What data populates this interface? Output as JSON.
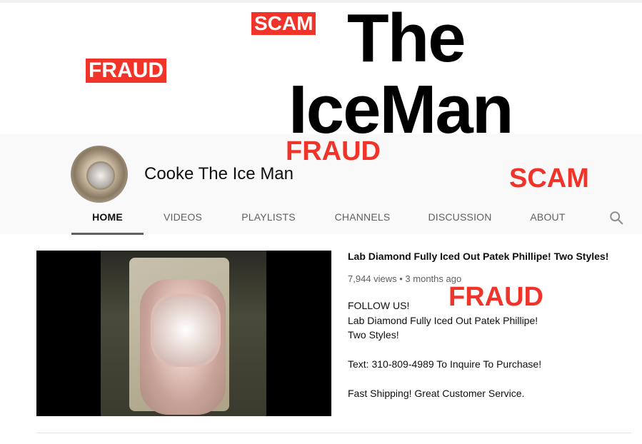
{
  "banner": {
    "title_line1": "The",
    "title_line2": "IceMan"
  },
  "stamps": {
    "scam_top": "SCAM",
    "fraud_left": "FRAUD",
    "fraud_mid": "FRAUD",
    "scam_right": "SCAM",
    "fraud_video": "FRAUD"
  },
  "channel": {
    "name": "Cooke The Ice Man"
  },
  "tabs": [
    {
      "label": "HOME",
      "active": true
    },
    {
      "label": "VIDEOS"
    },
    {
      "label": "PLAYLISTS"
    },
    {
      "label": "CHANNELS"
    },
    {
      "label": "DISCUSSION"
    },
    {
      "label": "ABOUT"
    }
  ],
  "featured_video": {
    "title": "Lab Diamond Fully Iced Out Patek Phillipe! Two Styles!",
    "meta": "7,944 views • 3 months ago",
    "description": [
      "FOLLOW US!",
      "Lab Diamond Fully Iced Out Patek Phillipe!",
      "Two Styles!",
      "",
      "Text: 310-809-4989 To Inquire To Purchase!",
      "",
      "Fast Shipping! Great Customer Service."
    ]
  },
  "icons": {
    "search": "search-icon"
  },
  "colors": {
    "stamp_red": "#f0342a",
    "header_bg": "#f9f9f9"
  }
}
